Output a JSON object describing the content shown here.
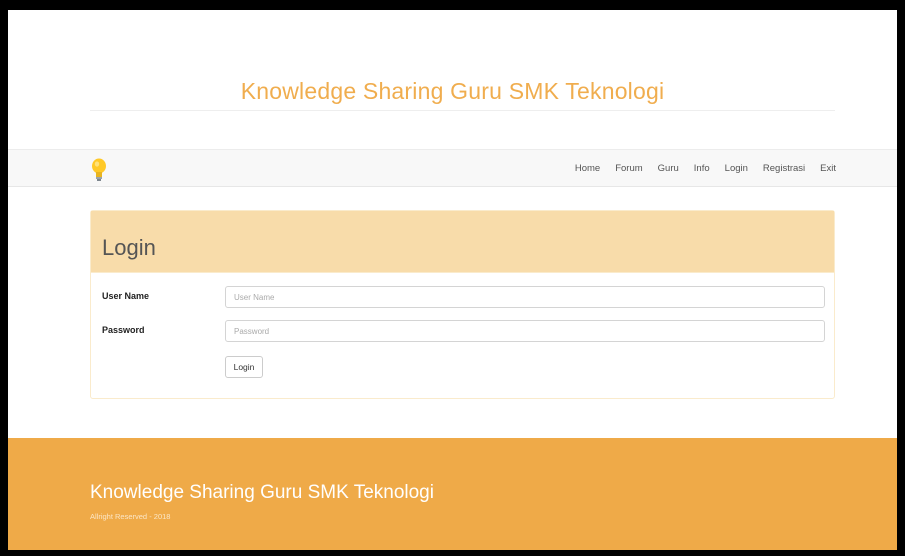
{
  "site": {
    "title": "Knowledge Sharing Guru SMK Teknologi"
  },
  "navbar": {
    "brand_icon": "lightbulb-icon",
    "items": [
      "Home",
      "Forum",
      "Guru",
      "Info",
      "Login",
      "Registrasi",
      "Exit"
    ]
  },
  "login_panel": {
    "title": "Login",
    "username": {
      "label": "User Name",
      "placeholder": "User Name",
      "value": ""
    },
    "password": {
      "label": "Password",
      "placeholder": "Password",
      "value": ""
    },
    "submit_label": "Login"
  },
  "footer": {
    "title": "Knowledge Sharing Guru SMK Teknologi",
    "copyright": "Allright Reserved - 2018"
  },
  "colors": {
    "accent": "#f0ad4e",
    "panel_heading": "#f8dcaa",
    "footer_bg": "#efaa48"
  }
}
